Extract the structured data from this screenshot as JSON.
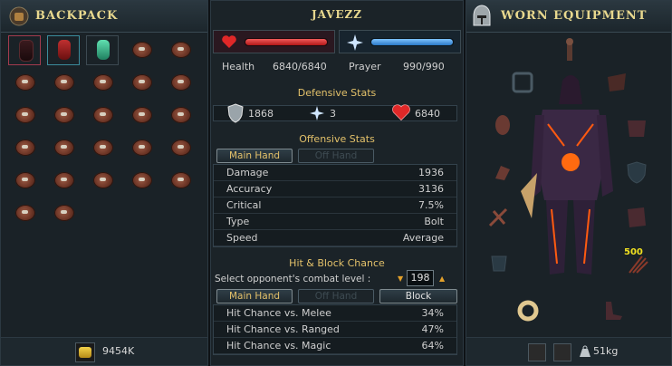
{
  "backpack": {
    "title": "BACKPACK",
    "coins_value": "9454K",
    "slot_count": 27
  },
  "stats": {
    "player_name": "JAVEZZ",
    "health_label": "Health",
    "health_value": "6840/6840",
    "prayer_label": "Prayer",
    "prayer_value": "990/990",
    "health_fill": 1.0,
    "prayer_fill": 1.0,
    "defensive_title": "Defensive Stats",
    "armour": "1868",
    "magic_def": "3",
    "life_points": "6840",
    "offensive_title": "Offensive Stats",
    "tabs": [
      "Main Hand",
      "Off Hand"
    ],
    "offense_rows": [
      {
        "k": "Damage",
        "v": "1936"
      },
      {
        "k": "Accuracy",
        "v": "3136"
      },
      {
        "k": "Critical",
        "v": "7.5%"
      },
      {
        "k": "Type",
        "v": "Bolt"
      },
      {
        "k": "Speed",
        "v": "Average"
      }
    ],
    "hit_title": "Hit & Block Chance",
    "opponent_label": "Select opponent's combat level :",
    "opponent_level": "198",
    "hit_tabs": [
      "Main Hand",
      "Off Hand",
      "Block"
    ],
    "hit_rows": [
      {
        "k": "Hit Chance vs. Melee",
        "v": "34%"
      },
      {
        "k": "Hit Chance vs. Ranged",
        "v": "47%"
      },
      {
        "k": "Hit Chance vs. Magic",
        "v": "64%"
      }
    ]
  },
  "equipment": {
    "title": "WORN EQUIPMENT",
    "ammo_count": "500",
    "weight": "51kg"
  },
  "colors": {
    "accent": "#e8d88e",
    "health": "#d83a3a",
    "prayer": "#4a9de0",
    "section": "#e3c16a"
  }
}
